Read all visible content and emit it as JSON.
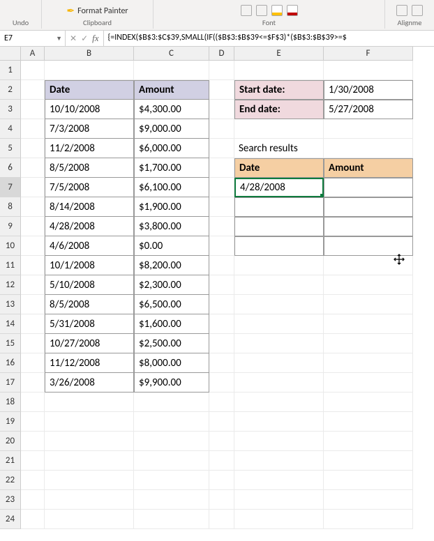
{
  "ribbon": {
    "undo_label": "Undo",
    "clipboard_label": "Clipboard",
    "format_painter": "Format Painter",
    "font_label": "Font",
    "alignment_label": "Alignme"
  },
  "formula_bar": {
    "cell_ref": "E7",
    "cancel": "✕",
    "enter": "✓",
    "fx": "fx",
    "formula": "{=INDEX($B$3:$C$39,SMALL(IF(($B$3:$B$39<=$F$3)*($B$3:$B$39>=$"
  },
  "columns": [
    "A",
    "B",
    "C",
    "D",
    "E",
    "F"
  ],
  "rows": [
    "1",
    "2",
    "3",
    "4",
    "5",
    "6",
    "7",
    "8",
    "9",
    "10",
    "11",
    "12",
    "13",
    "14",
    "15",
    "16",
    "17",
    "18",
    "19",
    "20",
    "21",
    "22",
    "23",
    "24"
  ],
  "main_table": {
    "headers": {
      "date": "Date",
      "amount": "Amount"
    },
    "rows": [
      {
        "date": "10/10/2008",
        "amount": "$4,300.00"
      },
      {
        "date": "7/3/2008",
        "amount": "$9,000.00"
      },
      {
        "date": "11/2/2008",
        "amount": "$6,000.00"
      },
      {
        "date": "8/5/2008",
        "amount": "$1,700.00"
      },
      {
        "date": "7/5/2008",
        "amount": "$6,100.00"
      },
      {
        "date": "8/14/2008",
        "amount": "$1,900.00"
      },
      {
        "date": "4/28/2008",
        "amount": "$3,800.00"
      },
      {
        "date": "4/6/2008",
        "amount": "$0.00"
      },
      {
        "date": "10/1/2008",
        "amount": "$8,200.00"
      },
      {
        "date": "5/10/2008",
        "amount": "$2,300.00"
      },
      {
        "date": "8/5/2008",
        "amount": "$6,500.00"
      },
      {
        "date": "5/31/2008",
        "amount": "$1,600.00"
      },
      {
        "date": "10/27/2008",
        "amount": "$2,500.00"
      },
      {
        "date": "11/12/2008",
        "amount": "$8,000.00"
      },
      {
        "date": "3/26/2008",
        "amount": "$9,900.00"
      }
    ]
  },
  "criteria": {
    "start_label": "Start date:",
    "start_value": "1/30/2008",
    "end_label": "End date:",
    "end_value": "5/27/2008"
  },
  "results": {
    "title": "Search results",
    "headers": {
      "date": "Date",
      "amount": "Amount"
    },
    "rows": [
      {
        "date": "4/28/2008",
        "amount": ""
      },
      {
        "date": "",
        "amount": ""
      },
      {
        "date": "",
        "amount": ""
      },
      {
        "date": "",
        "amount": ""
      }
    ]
  },
  "col_widths": {
    "A": 34,
    "B": 128,
    "C": 108,
    "D": 36,
    "E": 128,
    "F": 128,
    "G": 30
  }
}
